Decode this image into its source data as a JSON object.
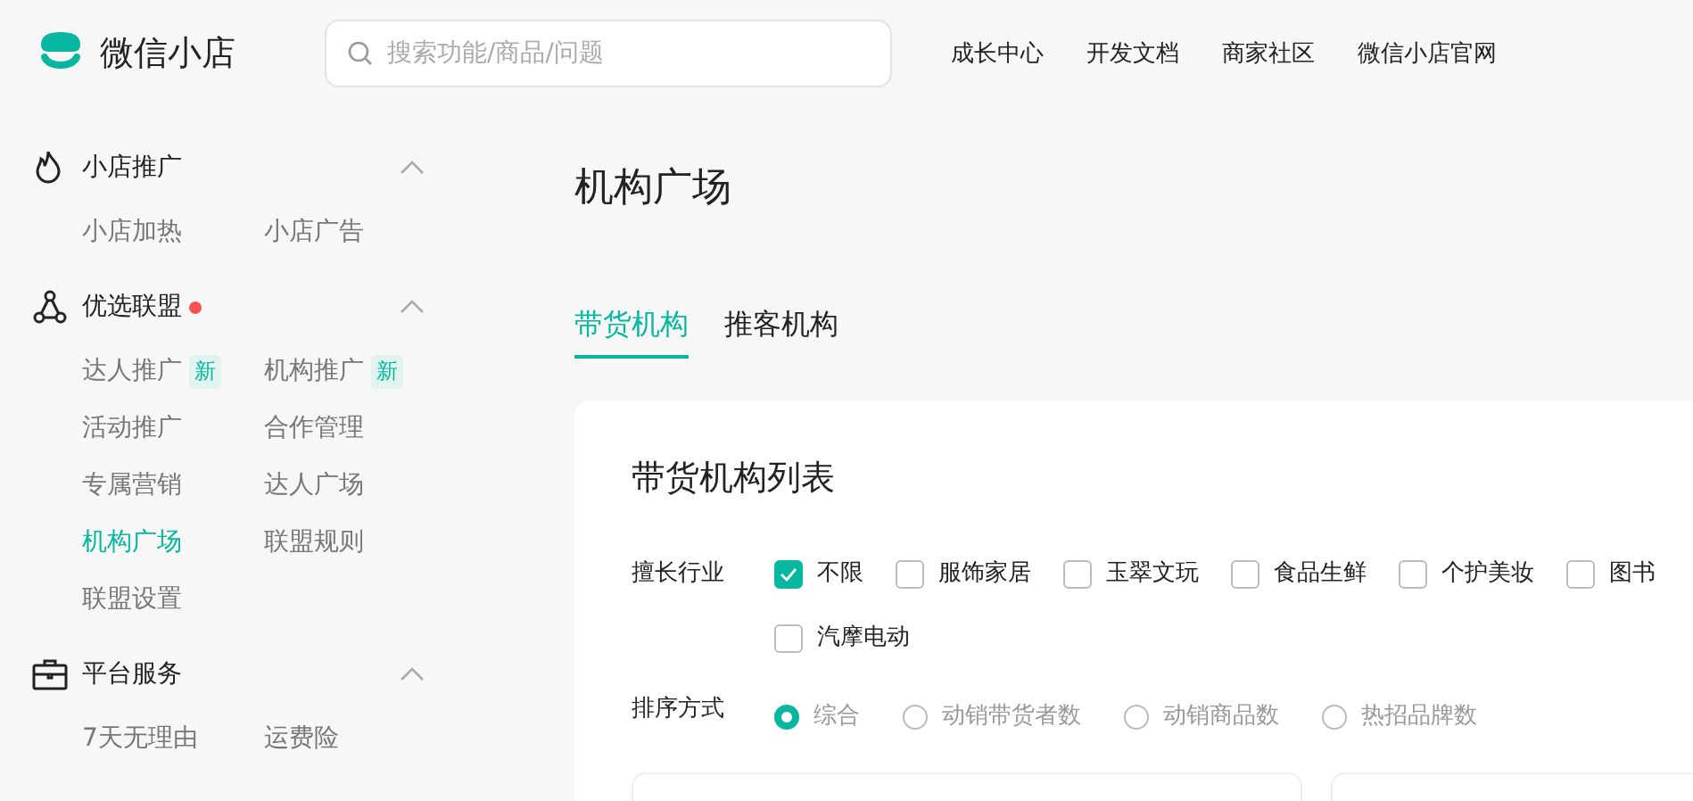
{
  "header": {
    "brand": "微信小店",
    "search": {
      "placeholder": "搜索功能/商品/问题"
    },
    "links": [
      "成长中心",
      "开发文档",
      "商家社区",
      "微信小店官网"
    ]
  },
  "sidebar": {
    "sections": [
      {
        "kind": "flame",
        "title": "小店推广",
        "expanded": true,
        "items": [
          {
            "label": "小店加热",
            "selected": false
          },
          {
            "label": "小店广告",
            "selected": false
          }
        ]
      },
      {
        "kind": "network",
        "title": "优选联盟",
        "dot": true,
        "expanded": true,
        "items": [
          {
            "label": "达人推广",
            "selected": false,
            "badge": "新"
          },
          {
            "label": "机构推广",
            "selected": false,
            "badge": "新"
          },
          {
            "label": "活动推广",
            "selected": false
          },
          {
            "label": "合作管理",
            "selected": false
          },
          {
            "label": "专属营销",
            "selected": false
          },
          {
            "label": "达人广场",
            "selected": false
          },
          {
            "label": "机构广场",
            "selected": true
          },
          {
            "label": "联盟规则",
            "selected": false
          },
          {
            "label": "联盟设置",
            "selected": false
          }
        ]
      },
      {
        "kind": "briefcase",
        "title": "平台服务",
        "expanded": true,
        "items": [
          {
            "label": "7天无理由",
            "selected": false
          },
          {
            "label": "运费险",
            "selected": false
          }
        ]
      }
    ]
  },
  "page_title": "机构广场",
  "tabs": [
    {
      "label": "带货机构",
      "selected": true
    },
    {
      "label": "推客机构",
      "selected": false
    }
  ],
  "card": {
    "title": "带货机构列表",
    "industry": {
      "label": "擅长行业",
      "options": [
        {
          "label": "不限",
          "checked": true
        },
        {
          "label": "服饰家居",
          "checked": false
        },
        {
          "label": "玉翠文玩",
          "checked": false
        },
        {
          "label": "食品生鲜",
          "checked": false
        },
        {
          "label": "个护美妆",
          "checked": false
        },
        {
          "label": "图书",
          "checked": false
        },
        {
          "label": "汽摩电动",
          "checked": false
        }
      ]
    },
    "sort": {
      "label": "排序方式",
      "options": [
        {
          "label": "综合",
          "selected": true
        },
        {
          "label": "动销带货者数",
          "selected": false
        },
        {
          "label": "动销商品数",
          "selected": false
        },
        {
          "label": "热招品牌数",
          "selected": false
        }
      ]
    }
  }
}
